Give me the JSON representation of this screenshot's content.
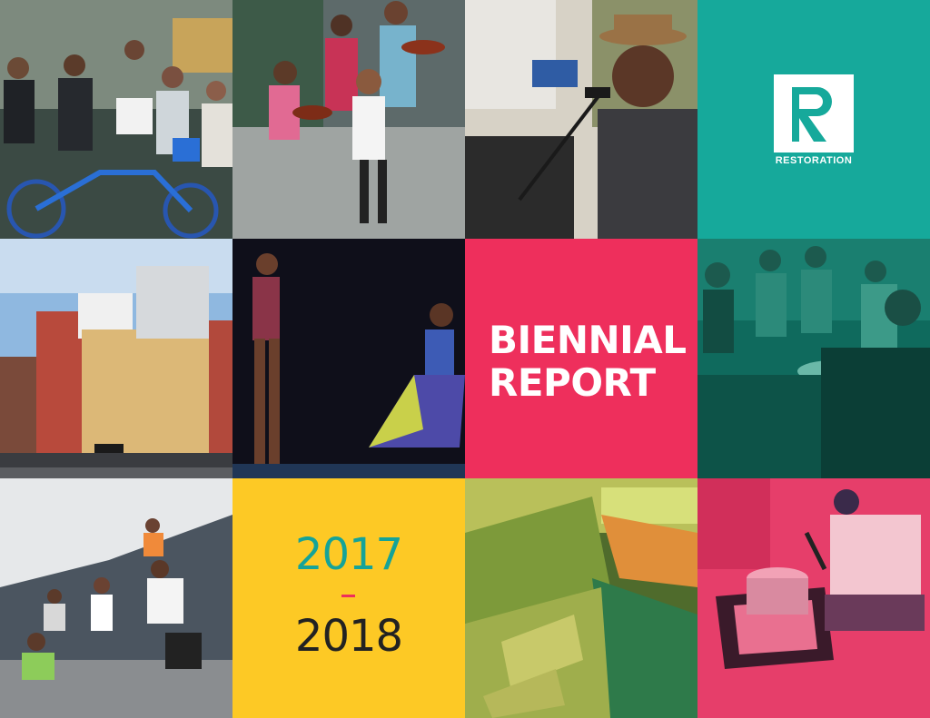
{
  "logo": {
    "wordmark": "RESTORATION"
  },
  "title": {
    "line1": "BIENNIAL",
    "line2": "REPORT"
  },
  "years": {
    "start": "2017",
    "end": "2018"
  },
  "colors": {
    "teal": "#16a99b",
    "pink": "#ee2f5c",
    "yellow": "#fdc925",
    "dark": "#222222"
  }
}
